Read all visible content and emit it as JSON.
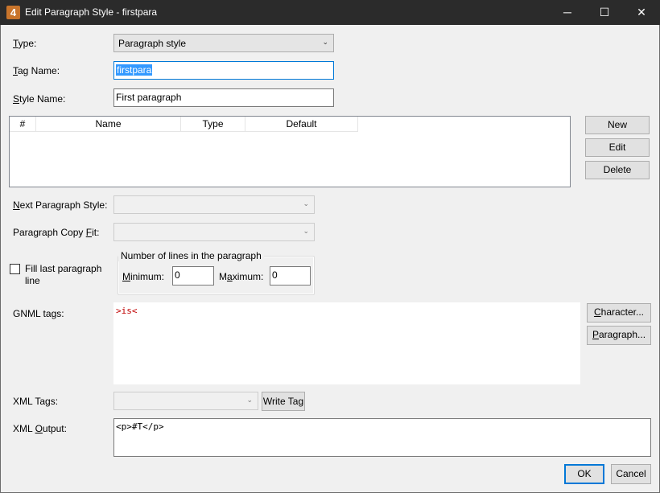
{
  "window": {
    "title": "Edit Paragraph Style - firstpara",
    "app_icon": "4",
    "minimize_icon": "─",
    "maximize_icon": "☐",
    "close_icon": "✕"
  },
  "form": {
    "type_label": "Type:",
    "type_value": "Paragraph style",
    "tag_label": "Tag Name:",
    "tag_value": "firstpara",
    "style_label": "Style Name:",
    "style_value": "First paragraph",
    "next_style_label": "Next Paragraph Style:",
    "next_style_value": "",
    "copyfit_label": "Paragraph Copy Fit:",
    "copyfit_value": "",
    "fill_last_label_line1": "Fill last paragraph",
    "fill_last_label_line2": "line",
    "fill_last_checked": false,
    "lines_group_title": "Number of lines in the paragraph",
    "minimum_label": "Minimum:",
    "minimum_value": "0",
    "maximum_label": "Maximum:",
    "maximum_value": "0",
    "gnml_label": "GNML tags:",
    "gnml_value": ">is<",
    "xml_tags_label": "XML Tags:",
    "xml_tags_value": "",
    "xml_output_label": "XML Output:",
    "xml_output_value": "<p>#T</p>"
  },
  "grid": {
    "columns": [
      "#",
      "Name",
      "Type",
      "Default"
    ],
    "rows": []
  },
  "buttons": {
    "new": "New",
    "edit": "Edit",
    "delete": "Delete",
    "character": "Character...",
    "paragraph": "Paragraph...",
    "write_tag": "Write Tag",
    "ok": "OK",
    "cancel": "Cancel"
  },
  "colors": {
    "titlebar": "#2b2b2b",
    "app_icon": "#c8742b",
    "gnml_text": "#c00000",
    "focus_border": "#0078d7",
    "selection": "#3399ff"
  },
  "icons": {
    "dropdown": "⌄"
  }
}
